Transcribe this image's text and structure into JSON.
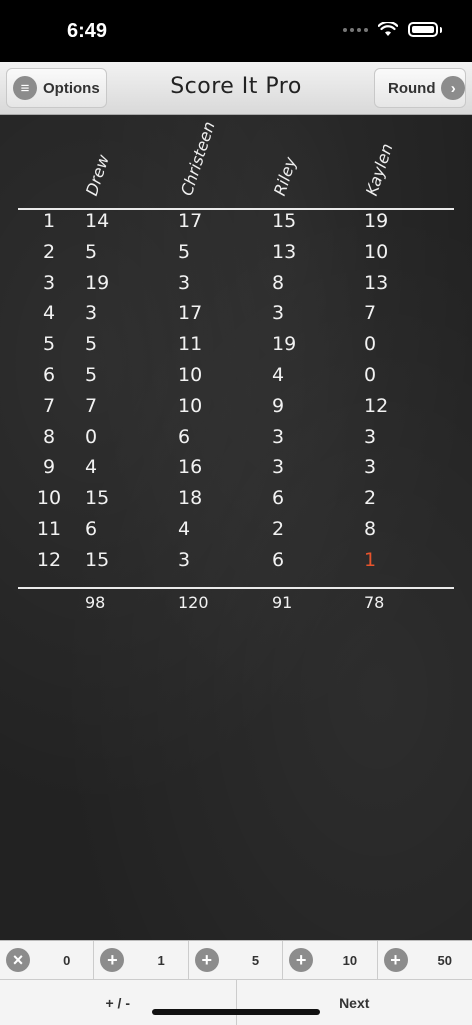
{
  "status": {
    "time": "6:49"
  },
  "nav": {
    "options_label": "Options",
    "title": "Score It Pro",
    "round_label": "Round"
  },
  "players": [
    "Drew",
    "Christeen",
    "Riley",
    "Kaylen"
  ],
  "rounds": [
    {
      "num": "1",
      "scores": [
        "14",
        "17",
        "15",
        "19"
      ]
    },
    {
      "num": "2",
      "scores": [
        "5",
        "5",
        "13",
        "10"
      ]
    },
    {
      "num": "3",
      "scores": [
        "19",
        "3",
        "8",
        "13"
      ]
    },
    {
      "num": "4",
      "scores": [
        "3",
        "17",
        "3",
        "7"
      ]
    },
    {
      "num": "5",
      "scores": [
        "5",
        "11",
        "19",
        "0"
      ]
    },
    {
      "num": "6",
      "scores": [
        "5",
        "10",
        "4",
        "0"
      ]
    },
    {
      "num": "7",
      "scores": [
        "7",
        "10",
        "9",
        "12"
      ]
    },
    {
      "num": "8",
      "scores": [
        "0",
        "6",
        "3",
        "3"
      ]
    },
    {
      "num": "9",
      "scores": [
        "4",
        "16",
        "3",
        "3"
      ]
    },
    {
      "num": "10",
      "scores": [
        "15",
        "18",
        "6",
        "2"
      ]
    },
    {
      "num": "11",
      "scores": [
        "6",
        "4",
        "2",
        "8"
      ]
    },
    {
      "num": "12",
      "scores": [
        "15",
        "3",
        "6",
        "1"
      ]
    }
  ],
  "totals": [
    "98",
    "120",
    "91",
    "78"
  ],
  "current_cell": {
    "round": 12,
    "player": 4
  },
  "colors": {
    "current_score": "#e8542c",
    "board": "#222222"
  },
  "toolbar": {
    "increments": [
      {
        "icon": "clear-icon",
        "value": "0"
      },
      {
        "icon": "plus-icon",
        "value": "1"
      },
      {
        "icon": "plus-icon",
        "value": "5"
      },
      {
        "icon": "plus-icon",
        "value": "10"
      },
      {
        "icon": "plus-icon",
        "value": "50"
      }
    ],
    "sign_label": "+ / -",
    "next_label": "Next"
  }
}
